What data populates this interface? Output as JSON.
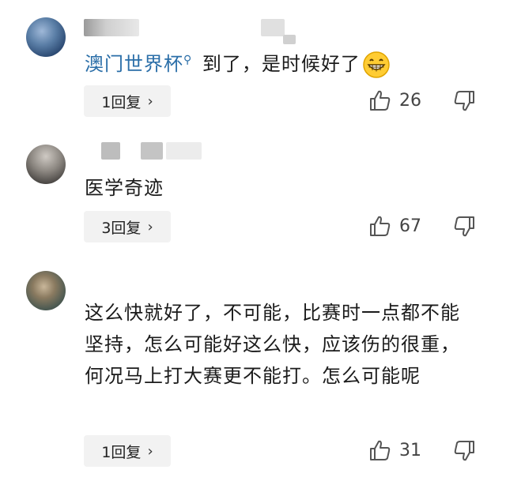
{
  "comments": [
    {
      "mention": "澳门世界杯",
      "text": " 到了，是时候好了",
      "emoji": "grinning-face-emoji",
      "reply_label": "1回复",
      "likes": "26"
    },
    {
      "text": "医学奇迹",
      "reply_label": "3回复",
      "likes": "67"
    },
    {
      "text": "这么快就好了，不可能，比赛时一点都不能坚持，怎么可能好这么快，应该伤的很重，何况马上打大赛更不能打。怎么可能呢",
      "reply_label": "1回复",
      "likes": "31"
    }
  ],
  "icons": {
    "like": "thumbs-up-icon",
    "dislike": "thumbs-down-icon",
    "chevron": "chevron-right-icon",
    "mention": "search-icon"
  },
  "colors": {
    "mention": "#2a6ea8",
    "reply_bg": "#f2f2f2",
    "text": "#1b1b1b"
  }
}
